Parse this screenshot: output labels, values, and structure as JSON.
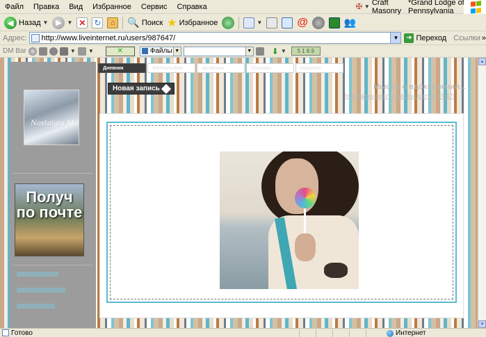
{
  "menu": {
    "items": [
      "Файл",
      "Правка",
      "Вид",
      "Избранное",
      "Сервис",
      "Справка"
    ],
    "links": [
      "Craft Masonry",
      "*Grand Lodge of Pennsylvania"
    ],
    "overflow": "»"
  },
  "toolbar": {
    "back_label": "Назад",
    "search_label": "Поиск",
    "favorites_label": "Избранное"
  },
  "address": {
    "label": "Адрес:",
    "url": "http://www.liveinternet.ru/users/987647/",
    "go_label": "Переход",
    "links_label": "Ссылки",
    "links_overflow": "»"
  },
  "dmbar": {
    "label": "DM Bar",
    "files_label": "Файлы",
    "progress_text": "5 1 8.9"
  },
  "page": {
    "tabs": [
      {
        "label": "Дневник",
        "active": true
      },
      {
        "label": "Фотоальбом",
        "active": false
      },
      {
        "label": "Цитатник",
        "active": false
      },
      {
        "label": "Отзывы",
        "active": false
      },
      {
        "label": "Новости",
        "active": false
      }
    ],
    "new_post_label": "Новая запись",
    "blog_title": "Мысль о вдохновении...",
    "blog_url": "http://www.liveinternet.ru/users/987647/",
    "mail_banner": "Получ по почте",
    "avatar_signature": "Nostalgia M"
  },
  "status": {
    "text": "Готово",
    "zone": "Интернет"
  },
  "colors": {
    "accent_teal": "#55bdd0",
    "sidebar_gray": "#9c9c9c",
    "dark_tab": "#3d3d3d"
  }
}
